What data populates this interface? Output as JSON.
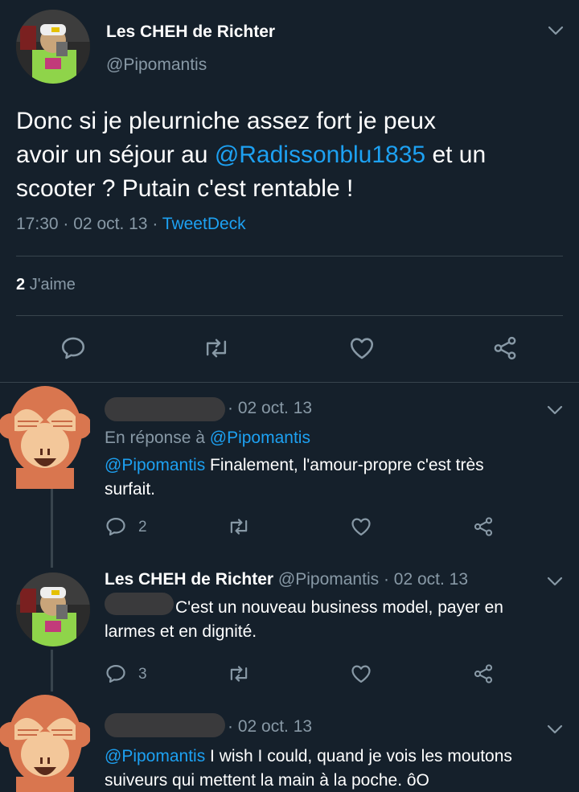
{
  "main_tweet": {
    "author_name": "Les CHEH de Richter",
    "author_handle": "@Pipomantis",
    "text_line1": "Donc si je pleurniche assez fort je peux",
    "text_line2_pre": "avoir un séjour au ",
    "text_line2_mention": "@Radissonblu1835",
    "text_line2_post": " et un",
    "text_line3": "scooter ? Putain c'est rentable !",
    "time": "17:30",
    "sep1": "·",
    "date": "02 oct. 13",
    "sep2": "·",
    "source": "TweetDeck",
    "likes_count": "2",
    "likes_label": "J'aime"
  },
  "replies": [
    {
      "meta": "· 02 oct. 13",
      "reply_to_prefix": "En réponse à ",
      "reply_to_handle": "@Pipomantis",
      "mention": "@Pipomantis",
      "text_line1": " Finalement, l'amour-propre c'est très",
      "text_line2": "surfait.",
      "reply_count": "2"
    },
    {
      "author_name": "Les CHEH de Richter",
      "author_handle_meta": "@Pipomantis · 02 oct. 13",
      "text_line1": "C'est un nouveau business model, payer en",
      "text_line2": "larmes et en dignité.",
      "reply_count": "3"
    },
    {
      "meta": "· 02 oct. 13",
      "mention": "@Pipomantis",
      "text_line1": " I wish I could, quand je vois les moutons",
      "text_line2": "suiveurs qui mettent la main à la poche. ôO"
    }
  ],
  "colors": {
    "background": "#15202b",
    "accent": "#1da1f2",
    "muted": "#8899a6",
    "divider": "#38444d",
    "monkey": "#d9764f"
  },
  "icons": [
    "reply-icon",
    "retweet-icon",
    "like-icon",
    "share-icon",
    "chevron-down-icon"
  ]
}
